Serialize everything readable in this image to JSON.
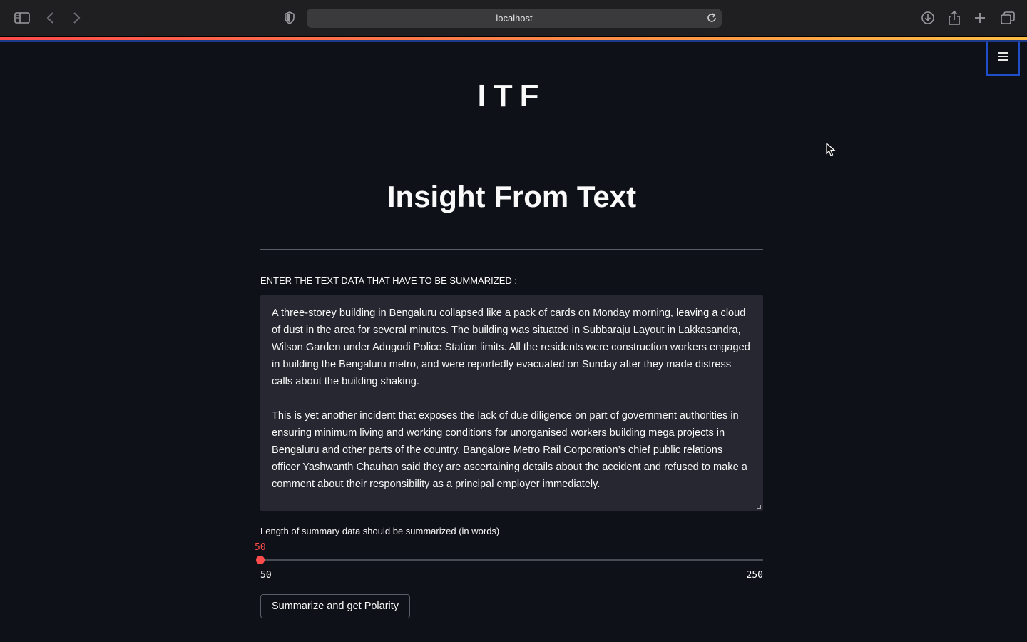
{
  "browser": {
    "url": "localhost",
    "icons": [
      "sidebar-icon",
      "back-icon",
      "forward-icon",
      "shield-icon",
      "reload-icon",
      "download-icon",
      "share-icon",
      "new-tab-icon",
      "tabs-overview-icon"
    ]
  },
  "app": {
    "logo_text": "ITF",
    "title": "Insight From Text",
    "accent_color": "#ff4b4b"
  },
  "input": {
    "label": "ENTER THE TEXT DATA THAT HAVE TO BE SUMMARIZED :",
    "paragraph1": "A three-storey building in Bengaluru collapsed like a pack of cards on Monday morning, leaving a cloud of dust in the area for several minutes. The building was situated in Subbaraju Layout in Lakkasandra, Wilson Garden under Adugodi Police Station limits. All the residents were construction workers engaged in building the Bengaluru metro, and were reportedly evacuated on Sunday after they made distress calls about the building shaking.",
    "paragraph2": "This is yet another incident that exposes the lack of due diligence on part of government authorities in ensuring minimum living and working conditions for unorganised workers building mega projects in Bengaluru and other parts of the country. Bangalore Metro Rail Corporation’s chief public relations officer Yashwanth Chauhan said they are ascertaining details about the accident and refused to make a comment about their responsibility as a principal employer immediately."
  },
  "slider": {
    "label": "Length of summary data should be summarized (in words)",
    "value": "50",
    "min": "50",
    "max": "250",
    "fraction": 0
  },
  "button": {
    "label": "Summarize and get Polarity"
  }
}
